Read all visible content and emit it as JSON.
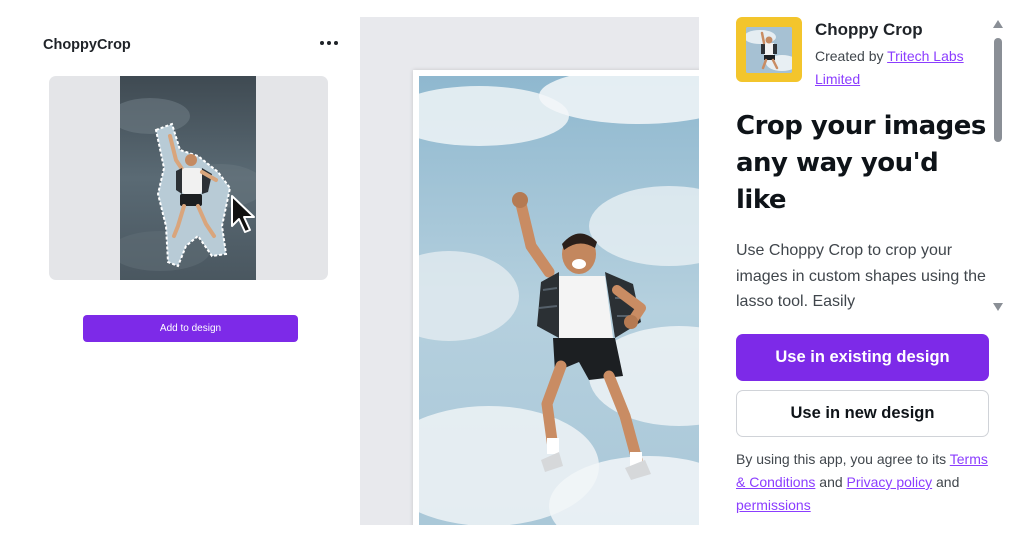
{
  "left_panel": {
    "app_title": "ChoppyCrop",
    "more_icon": "more-horizontal-icon",
    "add_button_label": "Add to design"
  },
  "sidebar": {
    "app_name": "Choppy Crop",
    "created_by_prefix": "Created by ",
    "author": "Tritech Labs Limited",
    "headline": "Crop your images any way you'd like",
    "description": "Use Choppy Crop to crop your images in custom shapes using the lasso tool. Easily",
    "primary_button": "Use in existing design",
    "secondary_button": "Use in new design",
    "legal": {
      "prefix": "By using this app, you agree to its ",
      "terms_link": "Terms & Conditions",
      "and_1": " and ",
      "privacy_link": "Privacy policy",
      "and_2": " and ",
      "permissions_link": "permissions"
    }
  },
  "colors": {
    "accent": "#7d2ae8",
    "link": "#8b3dff",
    "app_icon_bg": "#f3c52c",
    "canvas_bg": "#e8e9ed",
    "preview_bg": "#e4e5e8"
  }
}
